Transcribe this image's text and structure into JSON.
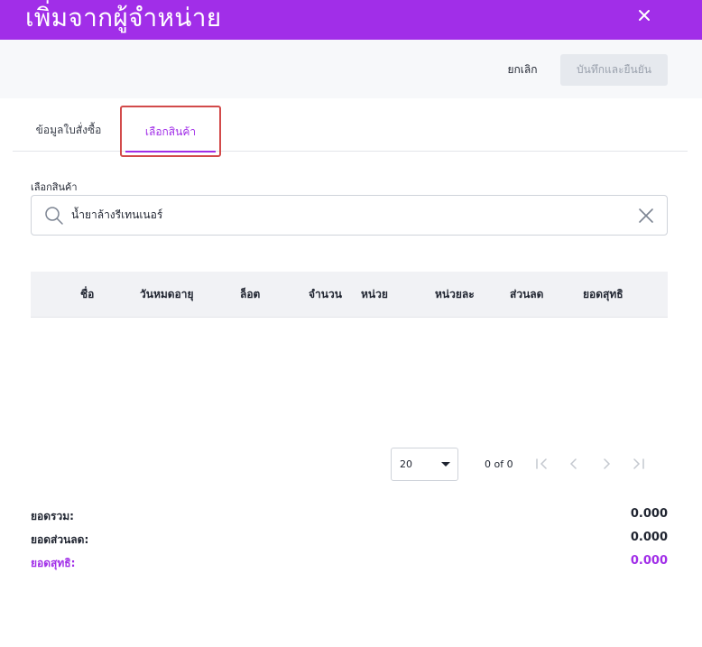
{
  "dialog": {
    "title": "เพิ่มจากผู้จำหน่าย"
  },
  "actions": {
    "cancel_label": "ยกเลิก",
    "confirm_label": "บันทึกและยืนยัน"
  },
  "tabs": [
    {
      "label": "ข้อมูลใบสั่งซื้อ",
      "active": false
    },
    {
      "label": "เลือกสินค้า",
      "active": true
    }
  ],
  "product_search": {
    "label": "เลือกสินค้า",
    "value": "น้ำยาล้างรีเทนเนอร์"
  },
  "table": {
    "columns": [
      "ชื่อ",
      "วันหมดอายุ",
      "ล็อต",
      "จำนวน",
      "หน่วย",
      "หน่วยละ",
      "ส่วนลด",
      "ยอดสุทธิ"
    ],
    "rows": []
  },
  "pagination": {
    "page_size": "20",
    "range": "0 of 0"
  },
  "summary": {
    "total_label": "ยอดรวม:",
    "total_value": "0.000",
    "discount_label": "ยอดส่วนลด:",
    "discount_value": "0.000",
    "net_label": "ยอดสุทธิ:",
    "net_value": "0.000"
  },
  "colors": {
    "accent": "#a12ee8",
    "tab_highlight_border": "#d24a4a"
  },
  "icons": {
    "close": "close-icon",
    "search": "search-icon",
    "clear": "clear-icon",
    "first_page": "first-page-icon",
    "prev_page": "chevron-left-icon",
    "next_page": "chevron-right-icon",
    "last_page": "last-page-icon"
  }
}
